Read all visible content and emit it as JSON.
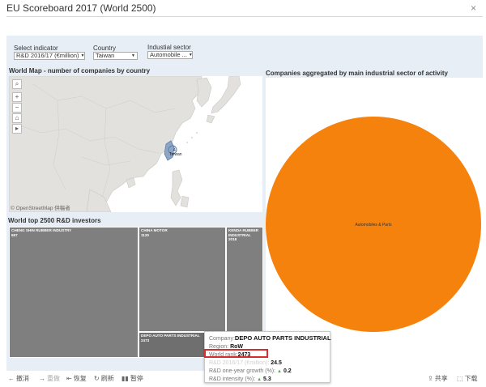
{
  "window": {
    "title": "EU Scoreboard 2017 (World 2500)",
    "close_glyph": "×"
  },
  "filters": {
    "indicator": {
      "label": "Select indicator",
      "value": "R&D 2016/17 (€million)"
    },
    "country": {
      "label": "Country",
      "value": "Taiwan"
    },
    "sector": {
      "label": "Industial sector",
      "value": "Automobile ..."
    }
  },
  "map_panel": {
    "title": "World Map - number of companies by country",
    "attribution": "© OpenStreetMap 供稿者",
    "marker_count": "4",
    "marker_label": "Taiwan",
    "controls": [
      "search-icon",
      "zoom-in-icon",
      "zoom-out-icon",
      "home-icon",
      "play-icon"
    ]
  },
  "treemap_panel": {
    "title": "World top 2500 R&D investors",
    "cells": [
      {
        "name": "CHENG SHIN RUBBER INDUSTRY",
        "value": "697"
      },
      {
        "name": "CHINA MOTOR",
        "value": "1120"
      },
      {
        "name": "KENDA RUBBER INDUSTRIAL",
        "value": "2018"
      },
      {
        "name": "DEPO AUTO PARTS INDUSTRIAL",
        "value": "2473"
      }
    ]
  },
  "sector_panel": {
    "title": "Companies aggregated by main industrial sector of activity",
    "slice_label": "Automobiles & Parts",
    "slice_color": "#f5820d"
  },
  "tooltip": {
    "company_label": "Company:",
    "company": "DEPO AUTO PARTS INDUSTRIAL",
    "region_label": "Region:",
    "region": "RoW",
    "rank_label": "World rank:",
    "rank": "2473",
    "rd_label": "R&D 2016/17 (€million):",
    "rd": "24.5",
    "growth_label": "R&D one-year growth (%):",
    "growth": "0.2",
    "intensity_label": "R&D intensity (%):",
    "intensity": "5.3"
  },
  "bottom_toolbar": {
    "undo": "撤消",
    "redo": "重做",
    "revert": "恢复",
    "refresh": "刷新",
    "pause": "暂停",
    "share": "共享",
    "download": "下载"
  }
}
